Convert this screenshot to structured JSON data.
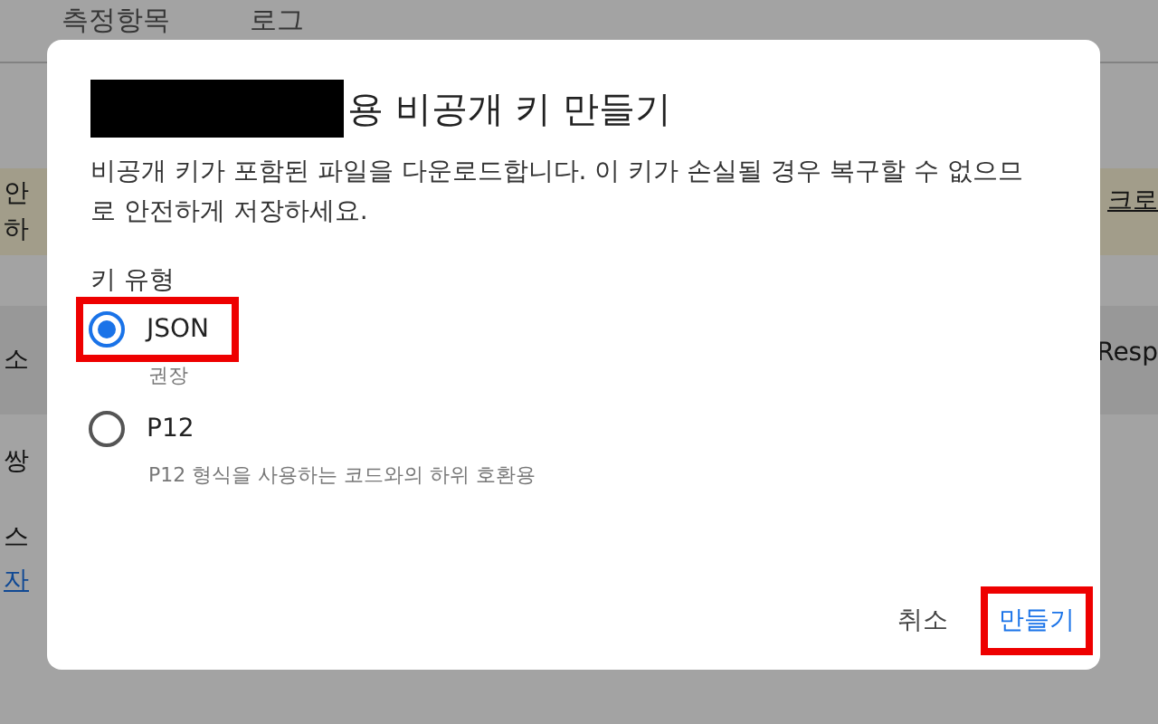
{
  "background": {
    "tabs": [
      {
        "label": "측정항목",
        "selected": false
      },
      {
        "label": "로그",
        "selected": false
      }
    ],
    "fragments_left": [
      "안",
      "하",
      "소",
      "쌍",
      "스",
      "자"
    ],
    "fragments_right": [
      "크로",
      "Resp"
    ]
  },
  "dialog": {
    "title": "용 비공개 키 만들기",
    "description": "비공개 키가 포함된 파일을 다운로드합니다. 이 키가 손실될 경우 복구할 수 없으므로 안전하게 저장하세요.",
    "key_type_label": "키 유형",
    "options": [
      {
        "label": "JSON",
        "hint": "권장",
        "selected": true,
        "highlighted": true
      },
      {
        "label": "P12",
        "hint": "P12 형식을 사용하는 코드와의 하위 호환용",
        "selected": false,
        "highlighted": false
      }
    ],
    "buttons": [
      {
        "label": "취소",
        "kind": "text",
        "highlighted": false
      },
      {
        "label": "만들기",
        "kind": "primary",
        "highlighted": true
      }
    ]
  }
}
